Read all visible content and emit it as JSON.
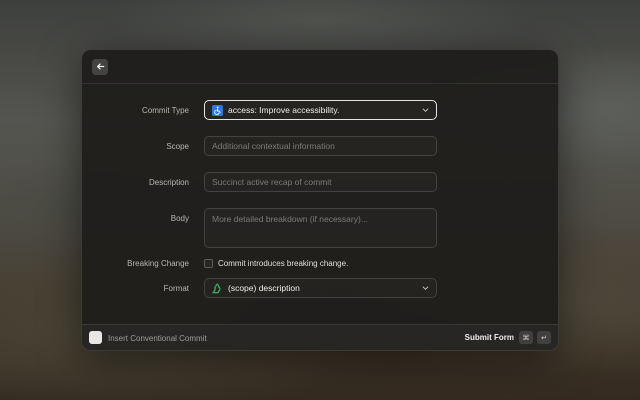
{
  "form": {
    "commit_type": {
      "label": "Commit Type",
      "value": "access: Improve accessibility.",
      "icon": "wheelchair-icon"
    },
    "scope": {
      "label": "Scope",
      "placeholder": "Additional contextual information"
    },
    "description": {
      "label": "Description",
      "placeholder": "Succinct active recap of commit"
    },
    "body": {
      "label": "Body",
      "placeholder": "More detailed breakdown (if necessary)..."
    },
    "breaking_change": {
      "label": "Breaking Change",
      "checkbox_label": "Commit introduces breaking change.",
      "checked": false
    },
    "format": {
      "label": "Format",
      "value": "(scope) description",
      "icon": "recycle-icon"
    }
  },
  "footer": {
    "title": "Insert Conventional Commit",
    "submit_label": "Submit Form",
    "shortcut_keys": [
      "⌘",
      "↵"
    ]
  },
  "colors": {
    "accent_border": "#e6e4df",
    "access_emoji_bg": "#2b78e4",
    "recycle_green": "#3aa655"
  }
}
